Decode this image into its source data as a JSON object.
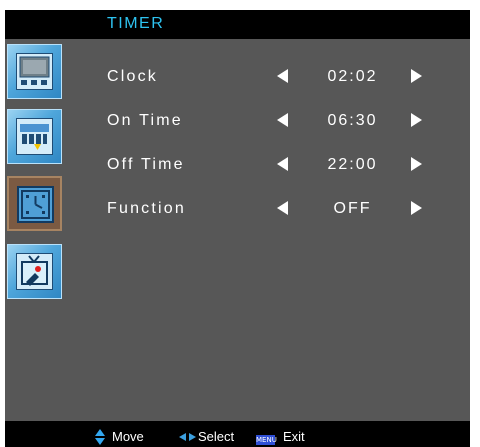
{
  "header": {
    "title": "TIMER"
  },
  "sidebar": {
    "items": [
      {
        "icon": "picture-icon",
        "selected": false
      },
      {
        "icon": "audio-icon",
        "selected": false
      },
      {
        "icon": "timer-icon",
        "selected": true
      },
      {
        "icon": "setup-icon",
        "selected": false
      }
    ]
  },
  "rows": [
    {
      "label": "Clock",
      "value": "02:02"
    },
    {
      "label": "On Time",
      "value": "06:30"
    },
    {
      "label": "Off Time",
      "value": "22:00"
    },
    {
      "label": "Function",
      "value": "OFF"
    }
  ],
  "footer": {
    "move_label": "Move",
    "select_label": "Select",
    "menu_key": "MENU",
    "exit_label": "Exit"
  },
  "colors": {
    "title": "#2ec3f0",
    "panel": "#575757",
    "bar": "#000000",
    "accent_blue": "#2f4fd6",
    "selected_tab": "#7b5a42"
  }
}
